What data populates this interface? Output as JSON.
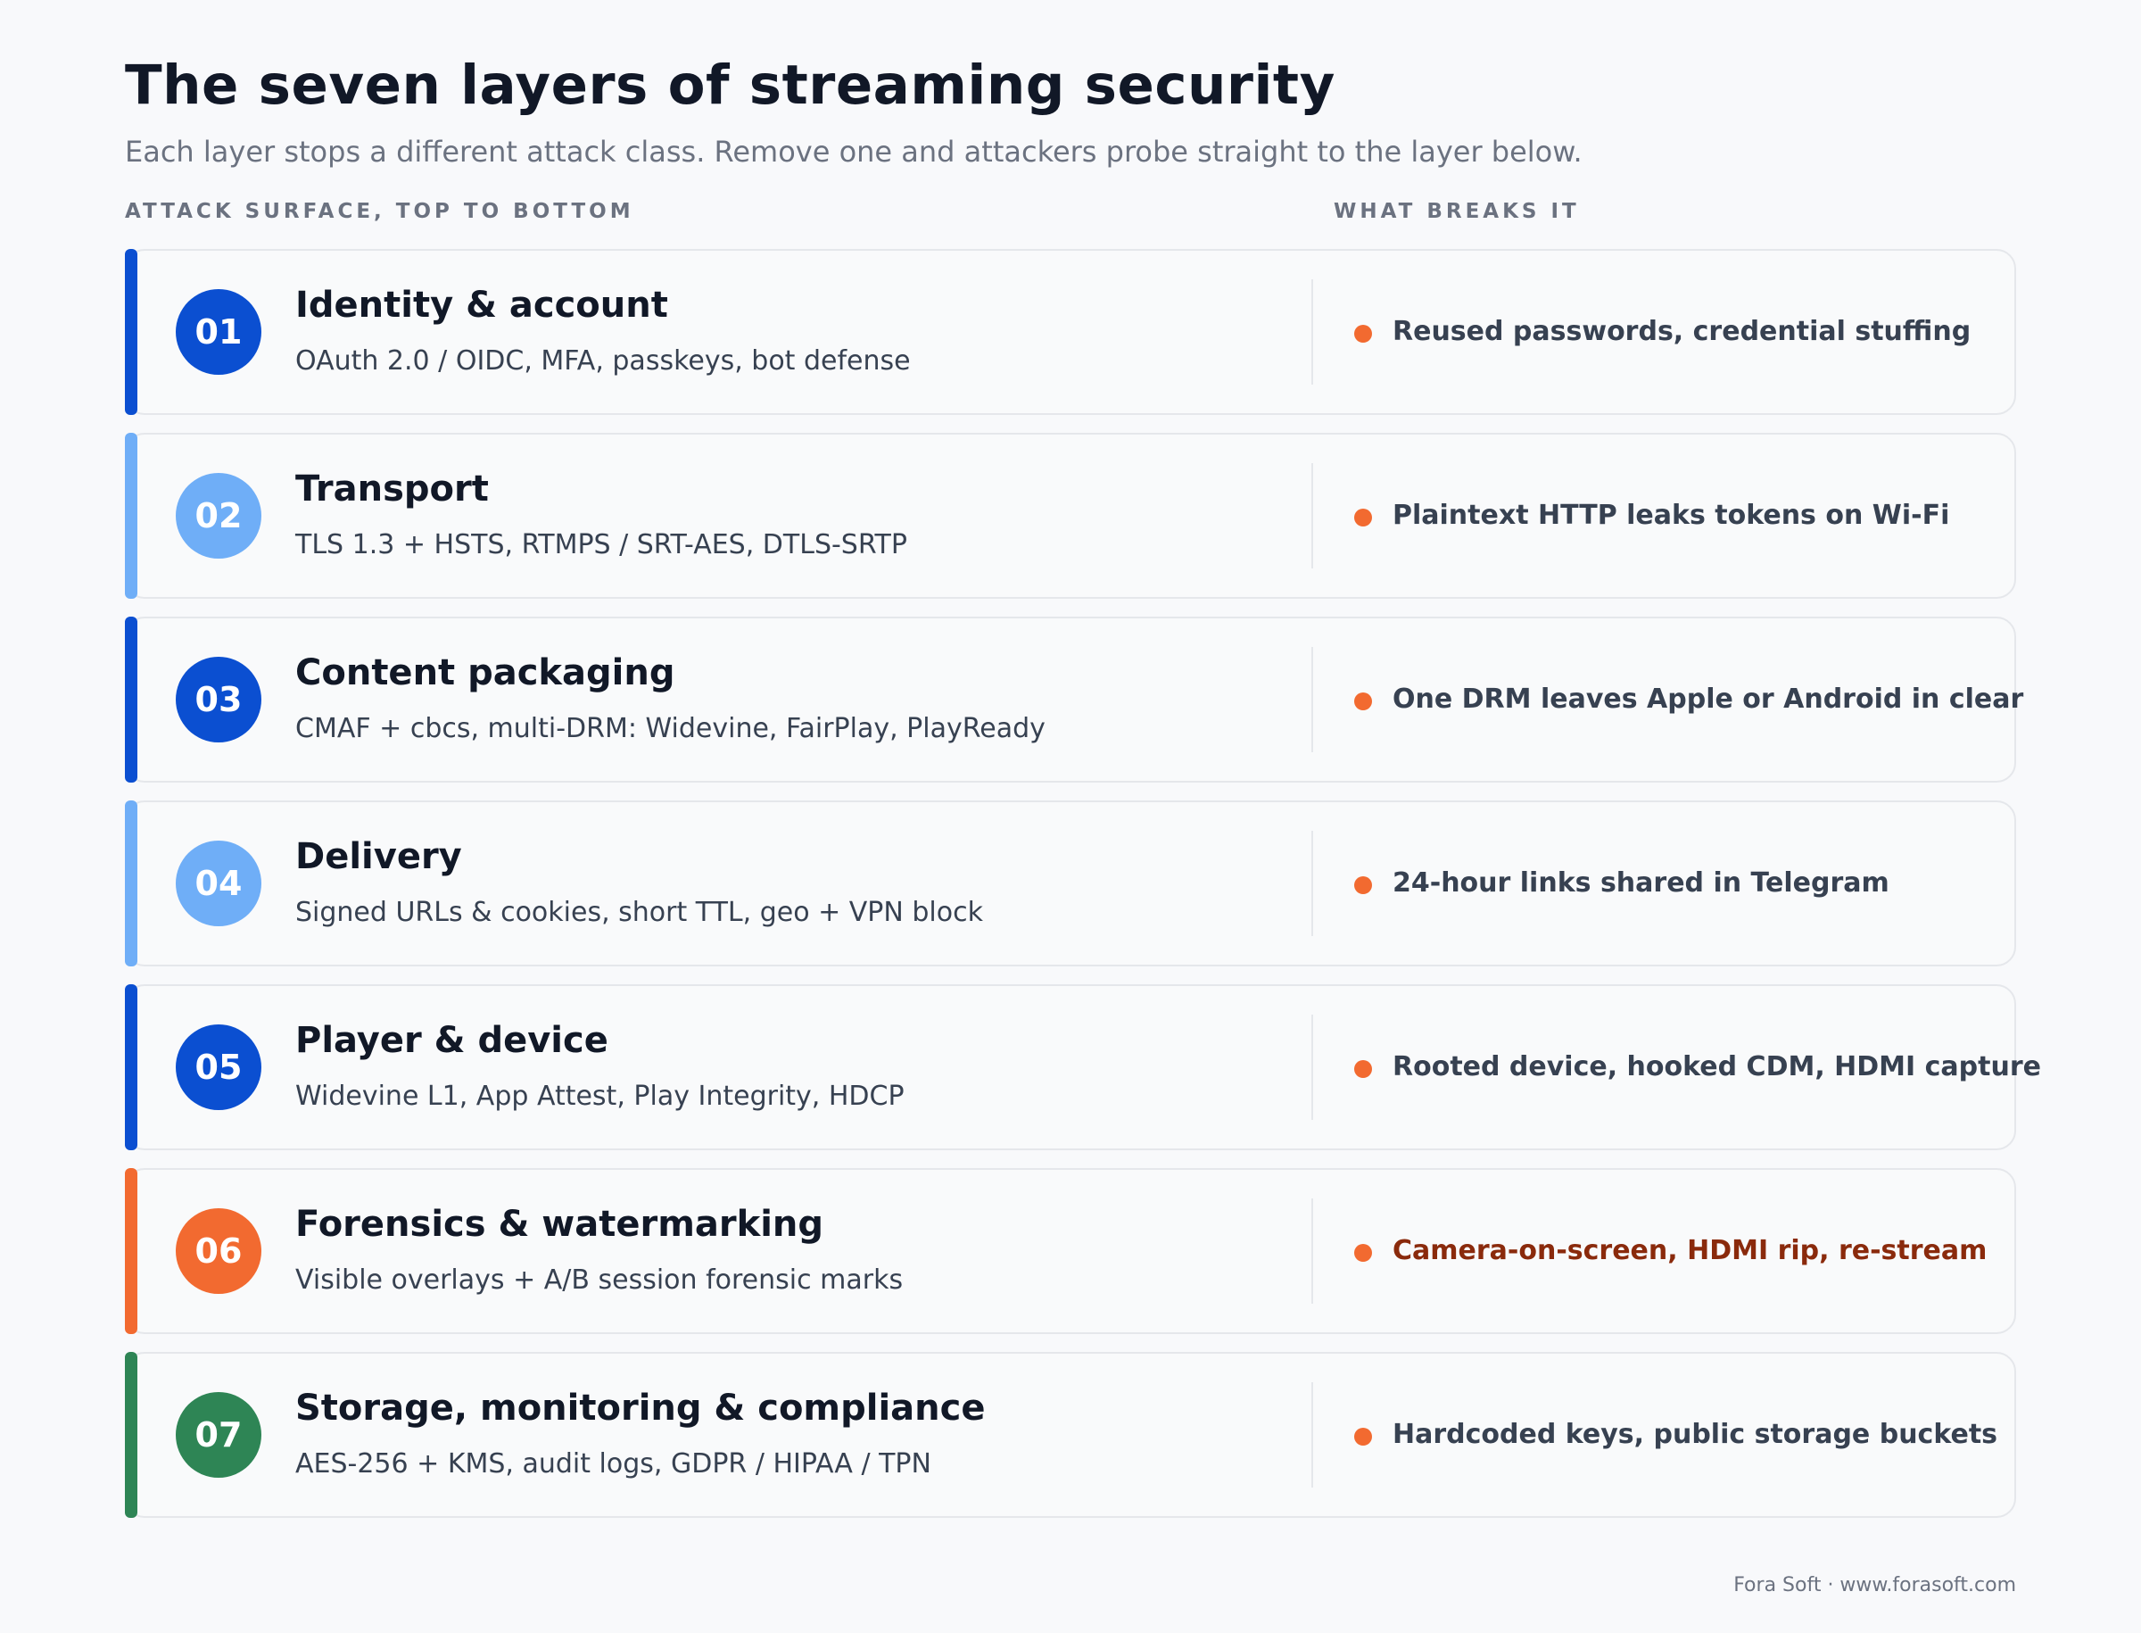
{
  "header": {
    "title": "The seven layers of streaming security",
    "subtitle": "Each layer stops a different attack class. Remove one and attackers probe straight to the layer below."
  },
  "columns": {
    "left": "ATTACK SURFACE, TOP TO BOTTOM",
    "right": "WHAT BREAKS IT"
  },
  "colors": {
    "dark_blue": "#0b4fd1",
    "light_blue": "#6faef7",
    "orange": "#f26a30",
    "green": "#2e8555"
  },
  "layers": [
    {
      "number": "01",
      "name": "Identity & account",
      "description": "OAuth 2.0 / OIDC, MFA, passkeys, bot defense",
      "threat": "Reused passwords, credential stuffing",
      "color": "#0b4fd1",
      "highlight": false
    },
    {
      "number": "02",
      "name": "Transport",
      "description": "TLS 1.3 + HSTS, RTMPS / SRT-AES, DTLS-SRTP",
      "threat": "Plaintext HTTP leaks tokens on Wi-Fi",
      "color": "#6faef7",
      "highlight": false
    },
    {
      "number": "03",
      "name": "Content packaging",
      "description": "CMAF + cbcs, multi-DRM: Widevine, FairPlay, PlayReady",
      "threat": "One DRM leaves Apple or Android in clear",
      "color": "#0b4fd1",
      "highlight": false
    },
    {
      "number": "04",
      "name": "Delivery",
      "description": "Signed URLs & cookies, short TTL, geo + VPN block",
      "threat": "24-hour links shared in Telegram",
      "color": "#6faef7",
      "highlight": false
    },
    {
      "number": "05",
      "name": "Player & device",
      "description": "Widevine L1, App Attest, Play Integrity, HDCP",
      "threat": "Rooted device, hooked CDM, HDMI capture",
      "color": "#0b4fd1",
      "highlight": false
    },
    {
      "number": "06",
      "name": "Forensics & watermarking",
      "description": "Visible overlays + A/B session forensic marks",
      "threat": "Camera-on-screen, HDMI rip, re-stream",
      "color": "#f26a30",
      "highlight": true
    },
    {
      "number": "07",
      "name": "Storage, monitoring & compliance",
      "description": "AES-256 + KMS, audit logs, GDPR / HIPAA / TPN",
      "threat": "Hardcoded keys, public storage buckets",
      "color": "#2e8555",
      "highlight": false
    }
  ],
  "footer": "Fora Soft · www.forasoft.com"
}
